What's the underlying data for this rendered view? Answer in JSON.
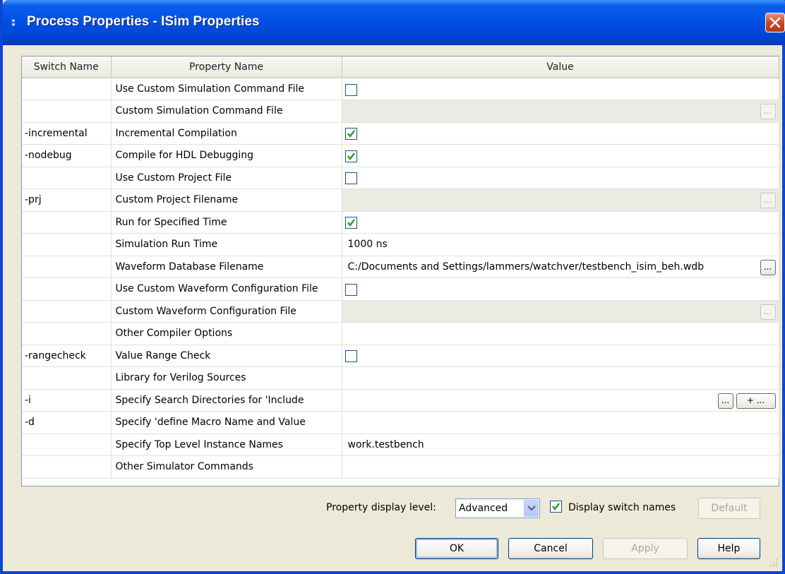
{
  "window": {
    "title": "Process Properties - ISim Properties",
    "title_icon": "⁑",
    "title_bar_color": "#0050E6"
  },
  "table": {
    "headers": [
      "Switch Name",
      "Property Name",
      "Value"
    ],
    "rows": [
      {
        "switch": "",
        "property": "Use Custom Simulation Command File",
        "value_type": "checkbox",
        "checked": false
      },
      {
        "switch": "",
        "property": "Custom Simulation Command File",
        "value_type": "file-disabled",
        "value": "",
        "browse_label": "..."
      },
      {
        "switch": "-incremental",
        "property": "Incremental Compilation",
        "value_type": "checkbox",
        "checked": true
      },
      {
        "switch": "-nodebug",
        "property": "Compile for HDL Debugging",
        "value_type": "checkbox",
        "checked": true
      },
      {
        "switch": "",
        "property": "Use Custom Project File",
        "value_type": "checkbox",
        "checked": false
      },
      {
        "switch": "-prj",
        "property": "Custom Project Filename",
        "value_type": "file-disabled",
        "value": "",
        "browse_label": "..."
      },
      {
        "switch": "",
        "property": "Run for Specified Time",
        "value_type": "checkbox",
        "checked": true
      },
      {
        "switch": "",
        "property": "Simulation Run Time",
        "value_type": "text",
        "value": "1000 ns"
      },
      {
        "switch": "",
        "property": "Waveform Database Filename",
        "value_type": "file",
        "value": "C:/Documents and Settings/lammers/watchver/testbench_isim_beh.wdb",
        "browse_label": "..."
      },
      {
        "switch": "",
        "property": "Use Custom Waveform Configuration File",
        "value_type": "checkbox",
        "checked": false
      },
      {
        "switch": "",
        "property": "Custom Waveform Configuration File",
        "value_type": "file-disabled",
        "value": "",
        "browse_label": "..."
      },
      {
        "switch": "",
        "property": "Other Compiler Options",
        "value_type": "text",
        "value": ""
      },
      {
        "switch": "-rangecheck",
        "property": "Value Range Check",
        "value_type": "checkbox",
        "checked": false
      },
      {
        "switch": "",
        "property": "Library for Verilog Sources",
        "value_type": "text",
        "value": ""
      },
      {
        "switch": "-i",
        "property": "Specify Search Directories for 'Include",
        "value_type": "list",
        "value": "",
        "browse_label": "...",
        "add_label": "+ ..."
      },
      {
        "switch": "-d",
        "property": "Specify 'define Macro Name and Value",
        "value_type": "text",
        "value": ""
      },
      {
        "switch": "",
        "property": "Specify Top Level Instance Names",
        "value_type": "text",
        "value": "work.testbench"
      },
      {
        "switch": "",
        "property": "Other Simulator Commands",
        "value_type": "text",
        "value": ""
      }
    ]
  },
  "footer": {
    "display_level_label": "Property display level:",
    "display_level_value": "Advanced",
    "display_switch_names_label": "Display switch names",
    "display_switch_names_checked": true,
    "default_label": "Default",
    "ok_label": "OK",
    "cancel_label": "Cancel",
    "apply_label": "Apply",
    "help_label": "Help"
  },
  "colors": {
    "dialog_bg": "#ECE9D8",
    "check_green": "#21A121",
    "disabled_cell_bg": "#EBEAE3"
  }
}
